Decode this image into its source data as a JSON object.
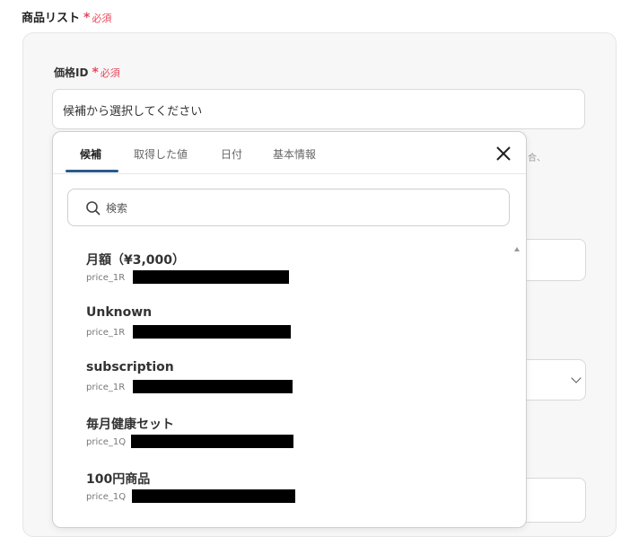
{
  "section": {
    "title": "商品リスト",
    "required_star": "*",
    "required_text": "必須"
  },
  "field": {
    "label": "価格ID",
    "required_star": "*",
    "required_text": "必須"
  },
  "select": {
    "value": "候補から選択してください"
  },
  "background": {
    "hint_fragment": "合、"
  },
  "popup": {
    "tabs": [
      "候補",
      "取得した値",
      "日付",
      "基本情報"
    ],
    "active_tab": "候補",
    "search_placeholder": "検索",
    "items": [
      {
        "label": "月額（¥3,000）",
        "id_prefix": "price_1R"
      },
      {
        "label": "Unknown",
        "id_prefix": "price_1R"
      },
      {
        "label": "subscription",
        "id_prefix": "price_1R"
      },
      {
        "label": "毎月健康セット",
        "id_prefix": "price_1Q"
      },
      {
        "label": "100円商品",
        "id_prefix": "price_1Q"
      }
    ]
  },
  "colors": {
    "required": "#e8475b",
    "tab_underline": "#2a5b8a",
    "card_bg": "#f7f7f7"
  },
  "icons": {
    "close": "close-icon",
    "search": "search-icon",
    "chevron": "chevron-down-icon",
    "scroll": "scroll-up-arrow-icon"
  }
}
